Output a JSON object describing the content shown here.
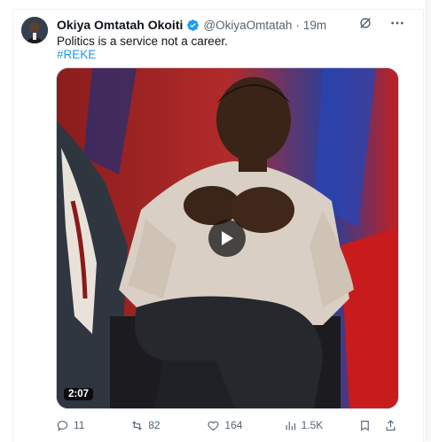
{
  "tweet": {
    "author_name": "Okiya Omtatah Okoiti",
    "handle": "@OkiyaOmtatah",
    "separator": "·",
    "time": "19m",
    "text": "Politics is a service not a career.",
    "hashtag": "#REKE"
  },
  "media": {
    "duration": "2:07",
    "play_icon": "play-icon"
  },
  "actions": {
    "replies": "11",
    "reposts": "82",
    "likes": "164",
    "views": "1.5K"
  },
  "colors": {
    "accent": "#1d9bf0",
    "secondary_text": "#536471",
    "primary_text": "#0f1419"
  }
}
